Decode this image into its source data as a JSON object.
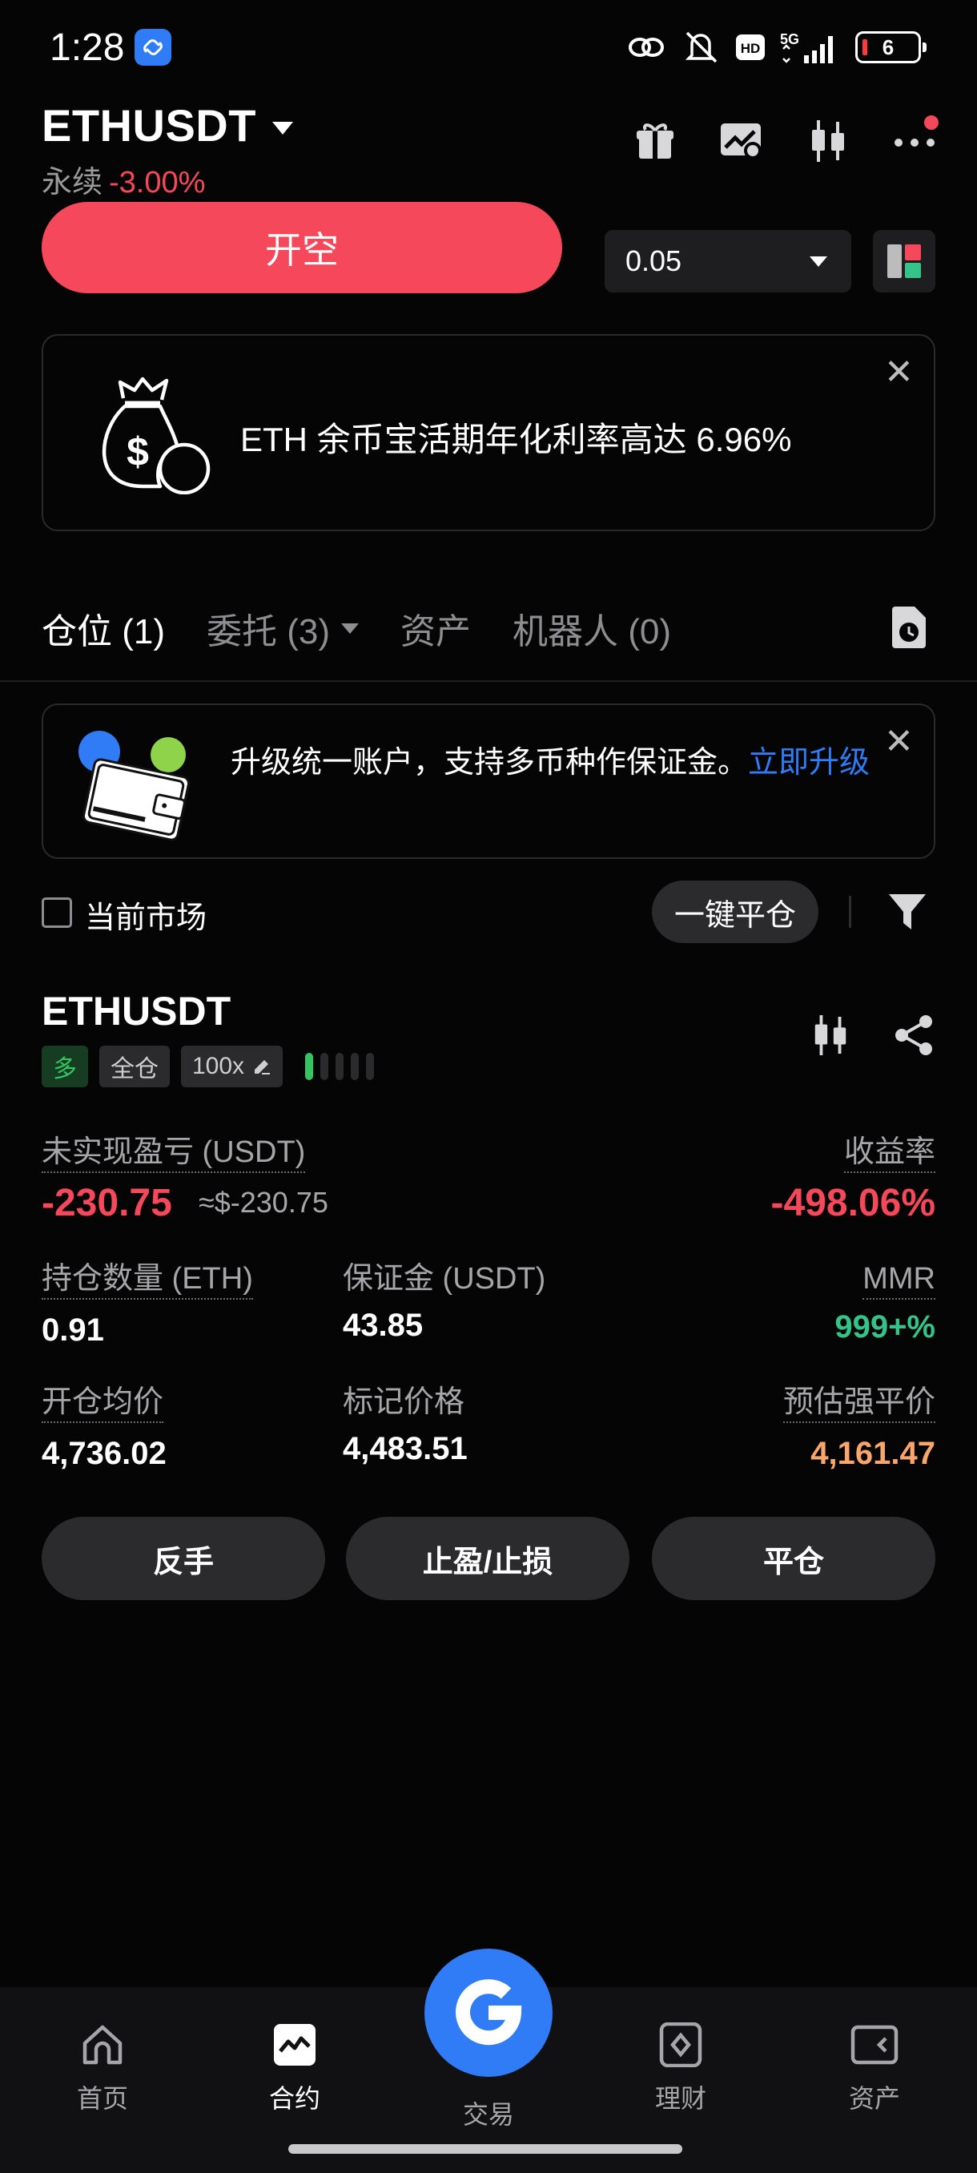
{
  "status_bar": {
    "time": "1:28",
    "network": "5G",
    "hd": "HD",
    "battery": "6"
  },
  "header": {
    "symbol": "ETHUSDT",
    "subtitle_label": "永续",
    "change": "-3.00%"
  },
  "trade": {
    "open_short_label": "开空",
    "quantity_value": "0.05"
  },
  "promo": {
    "text": "ETH 余币宝活期年化利率高达 6.96%"
  },
  "tabs": [
    {
      "label": "仓位 (1)"
    },
    {
      "label": "委托 (3)"
    },
    {
      "label": "资产"
    },
    {
      "label": "机器人 (0)"
    }
  ],
  "upgrade": {
    "text": "升级统一账户，支持多币种作保证金。",
    "link": "立即升级"
  },
  "filter": {
    "current_market_label": "当前市场",
    "close_all_label": "一键平仓"
  },
  "position": {
    "symbol": "ETHUSDT",
    "side": "多",
    "margin_mode": "全仓",
    "leverage": "100x",
    "risk_level": 1,
    "unrealized_pnl_label": "未实现盈亏 (USDT)",
    "unrealized_pnl": "-230.75",
    "unrealized_pnl_usd": "≈$-230.75",
    "roe_label": "收益率",
    "roe": "-498.06%",
    "size_label": "持仓数量 (ETH)",
    "size": "0.91",
    "margin_label": "保证金 (USDT)",
    "margin": "43.85",
    "mmr_label": "MMR",
    "mmr": "999+%",
    "entry_label": "开仓均价",
    "entry": "4,736.02",
    "mark_label": "标记价格",
    "mark": "4,483.51",
    "liq_label": "预估强平价",
    "liq": "4,161.47",
    "reverse_label": "反手",
    "tpsl_label": "止盈/止损",
    "close_label": "平仓"
  },
  "bottom_nav": {
    "home": "首页",
    "contract": "合约",
    "trade": "交易",
    "finance": "理财",
    "assets": "资产"
  },
  "colors": {
    "red": "#f5485b",
    "green": "#34c48a",
    "orange": "#f9a66b",
    "blue": "#2f7cf6"
  }
}
